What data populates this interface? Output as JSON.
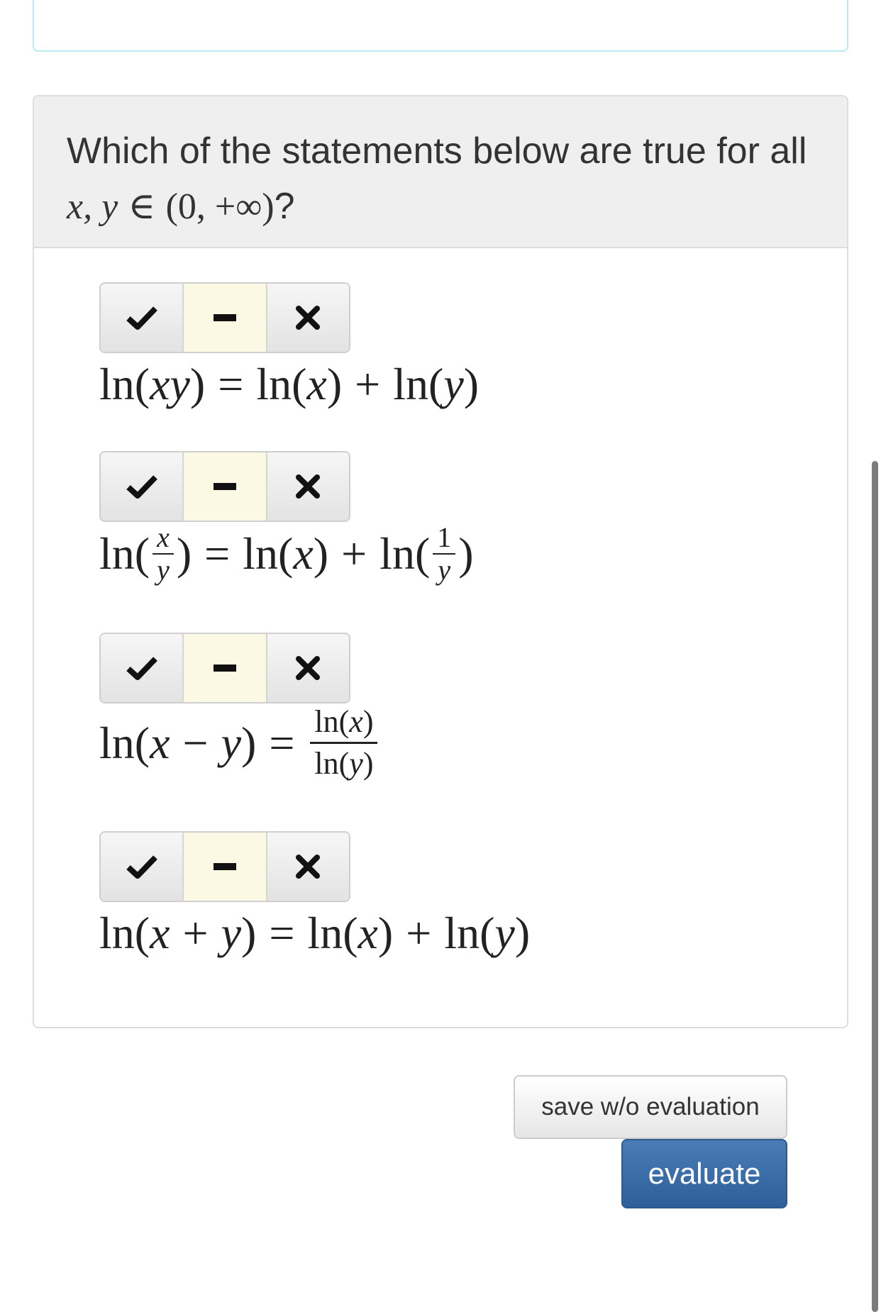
{
  "question": {
    "text_prefix": "Which of the statements below are true for all",
    "vars": "x, y",
    "in_symbol": "∈",
    "interval": "(0, +∞)",
    "suffix": "?"
  },
  "icons": {
    "true_option": "check-icon",
    "neutral_option": "minus-icon",
    "false_option": "cross-icon"
  },
  "colors": {
    "selected_option_bg": "#fbf8e4",
    "primary_button": "#2d5f99",
    "panel_border_info": "#bce8f1",
    "heading_bg": "#efefef"
  },
  "statements": [
    {
      "selected": "neutral"
    },
    {
      "selected": "neutral"
    },
    {
      "selected": "neutral"
    },
    {
      "selected": "neutral"
    }
  ],
  "math": {
    "ln": "ln",
    "lp": "(",
    "rp": ")",
    "eq": "=",
    "plus": "+",
    "minus": "−",
    "x": "x",
    "y": "y",
    "xy": "xy",
    "one": "1"
  },
  "buttons": {
    "save_label": "save w/o evaluation",
    "evaluate_label": "evaluate"
  }
}
